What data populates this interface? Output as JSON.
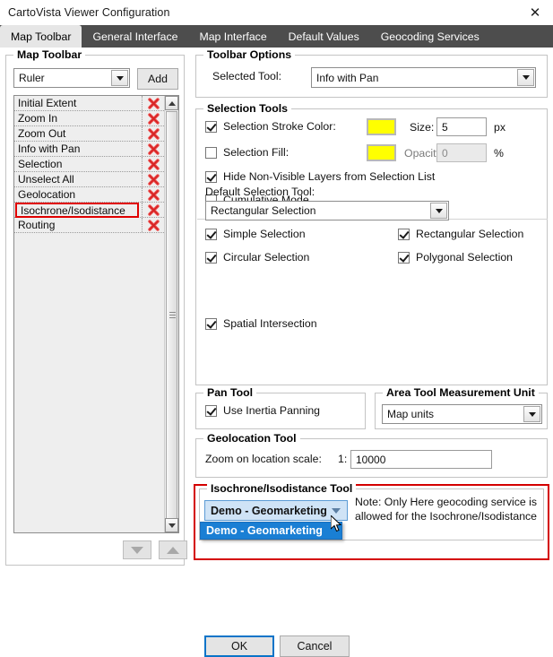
{
  "window": {
    "title": "CartoVista Viewer Configuration",
    "close_icon": "close-icon"
  },
  "tabs": [
    {
      "label": "Map Toolbar",
      "active": true
    },
    {
      "label": "General Interface",
      "active": false
    },
    {
      "label": "Map Interface",
      "active": false
    },
    {
      "label": "Default Values",
      "active": false
    },
    {
      "label": "Geocoding Services",
      "active": false
    }
  ],
  "map_toolbar": {
    "legend": "Map Toolbar",
    "tool_select_value": "Ruler",
    "add_label": "Add",
    "items": [
      {
        "label": "Initial Extent",
        "highlight": false
      },
      {
        "label": "Zoom In",
        "highlight": false
      },
      {
        "label": "Zoom Out",
        "highlight": false
      },
      {
        "label": "Info with Pan",
        "highlight": false
      },
      {
        "label": "Selection",
        "highlight": false
      },
      {
        "label": "Unselect All",
        "highlight": false
      },
      {
        "label": "Geolocation",
        "highlight": false
      },
      {
        "label": "Isochrone/Isodistance",
        "highlight": true
      },
      {
        "label": "Routing",
        "highlight": false
      }
    ],
    "delete_icon": "delete-x-icon",
    "move_down_icon": "arrow-down-icon",
    "move_up_icon": "arrow-up-icon",
    "scroll_up_icon": "scroll-up-icon",
    "scroll_down_icon": "scroll-down-icon"
  },
  "toolbar_options": {
    "legend": "Toolbar Options",
    "selected_tool_label": "Selected Tool:",
    "selected_tool_value": "Info with Pan"
  },
  "selection_tools": {
    "legend": "Selection Tools",
    "stroke_color_label": "Selection Stroke Color:",
    "stroke_color_checked": true,
    "stroke_color_value": "#ffff00",
    "size_label": "Size:",
    "size_value": "5",
    "size_unit": "px",
    "fill_label": "Selection Fill:",
    "fill_checked": false,
    "fill_color_value": "#ffff00",
    "opacity_label": "Opacity:",
    "opacity_value": "0",
    "opacity_unit": "%",
    "hide_layers_label": "Hide Non-Visible Layers from Selection List",
    "hide_layers_checked": true,
    "cumulative_label": "Cumulative Mode",
    "cumulative_checked": false,
    "simple_label": "Simple Selection",
    "simple_checked": true,
    "rectangular_label": "Rectangular Selection",
    "rectangular_checked": true,
    "circular_label": "Circular Selection",
    "circular_checked": true,
    "polygonal_label": "Polygonal Selection",
    "polygonal_checked": true,
    "default_tool_label": "Default Selection Tool:",
    "default_tool_value": "Rectangular Selection",
    "spatial_intersection_label": "Spatial Intersection",
    "spatial_intersection_checked": true
  },
  "pan_tool": {
    "legend": "Pan Tool",
    "inertia_label": "Use Inertia Panning",
    "inertia_checked": true
  },
  "area_tool": {
    "legend": "Area Tool Measurement Unit",
    "unit_value": "Map units"
  },
  "geolocation_tool": {
    "legend": "Geolocation Tool",
    "zoom_scale_label": "Zoom on location scale:",
    "zoom_scale_prefix": "1:",
    "zoom_scale_value": "10000"
  },
  "isochrone_tool": {
    "legend": "Isochrone/Isodistance Tool",
    "service_value": "Demo - Geomarketing",
    "dropdown_option": "Demo - Geomarketing",
    "note": "Note: Only Here geocoding service is allowed for the Isochrone/Isodistance",
    "highlight_color": "#d40000"
  },
  "footer": {
    "ok_label": "OK",
    "cancel_label": "Cancel"
  }
}
